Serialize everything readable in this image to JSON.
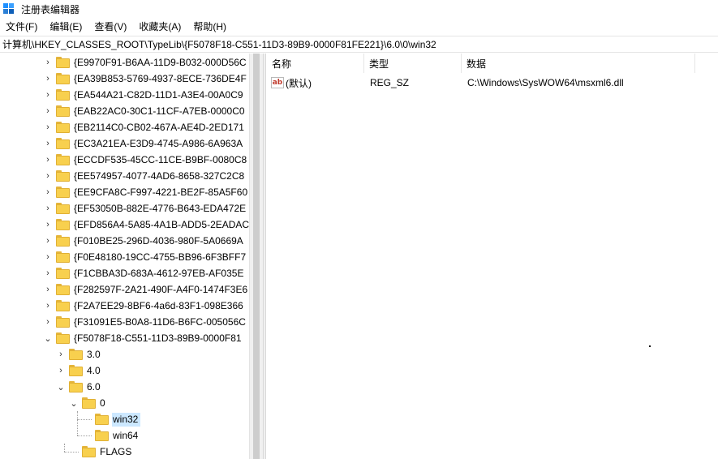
{
  "window": {
    "title": "注册表编辑器"
  },
  "menu": [
    "文件(F)",
    "编辑(E)",
    "查看(V)",
    "收藏夹(A)",
    "帮助(H)"
  ],
  "address": "计算机\\HKEY_CLASSES_ROOT\\TypeLib\\{F5078F18-C551-11D3-89B9-0000F81FE221}\\6.0\\0\\win32",
  "tree": {
    "items": [
      {
        "label": "{E9970F91-B6AA-11D9-B032-000D56C",
        "expander": "›"
      },
      {
        "label": "{EA39B853-5769-4937-8ECE-736DE4F",
        "expander": "›"
      },
      {
        "label": "{EA544A21-C82D-11D1-A3E4-00A0C9",
        "expander": "›"
      },
      {
        "label": "{EAB22AC0-30C1-11CF-A7EB-0000C0",
        "expander": "›"
      },
      {
        "label": "{EB2114C0-CB02-467A-AE4D-2ED171",
        "expander": "›"
      },
      {
        "label": "{EC3A21EA-E3D9-4745-A986-6A963A",
        "expander": "›"
      },
      {
        "label": "{ECCDF535-45CC-11CE-B9BF-0080C8",
        "expander": "›"
      },
      {
        "label": "{EE574957-4077-4AD6-8658-327C2C8",
        "expander": "›"
      },
      {
        "label": "{EE9CFA8C-F997-4221-BE2F-85A5F60",
        "expander": "›"
      },
      {
        "label": "{EF53050B-882E-4776-B643-EDA472E",
        "expander": "›"
      },
      {
        "label": "{EFD856A4-5A85-4A1B-ADD5-2EADAC",
        "expander": "›"
      },
      {
        "label": "{F010BE25-296D-4036-980F-5A0669A",
        "expander": "›"
      },
      {
        "label": "{F0E48180-19CC-4755-BB96-6F3BFF7",
        "expander": "›"
      },
      {
        "label": "{F1CBBA3D-683A-4612-97EB-AF035E",
        "expander": "›"
      },
      {
        "label": "{F282597F-2A21-490F-A4F0-1474F3E6",
        "expander": "›"
      },
      {
        "label": "{F2A7EE29-8BF6-4a6d-83F1-098E366",
        "expander": "›"
      },
      {
        "label": "{F31091E5-B0A8-11D6-B6FC-005056C",
        "expander": "›"
      },
      {
        "label": "{F5078F18-C551-11D3-89B9-0000F81",
        "expander": "⌄"
      }
    ],
    "children": {
      "v30": "3.0",
      "v40": "4.0",
      "v60": "6.0",
      "n0": "0",
      "win32": "win32",
      "win64": "win64",
      "flags": "FLAGS"
    }
  },
  "list": {
    "columns": {
      "name": "名称",
      "type": "类型",
      "data": "数据"
    },
    "rows": [
      {
        "name": "(默认)",
        "type": "REG_SZ",
        "data": "C:\\Windows\\SysWOW64\\msxml6.dll",
        "icon": "ab"
      }
    ]
  }
}
